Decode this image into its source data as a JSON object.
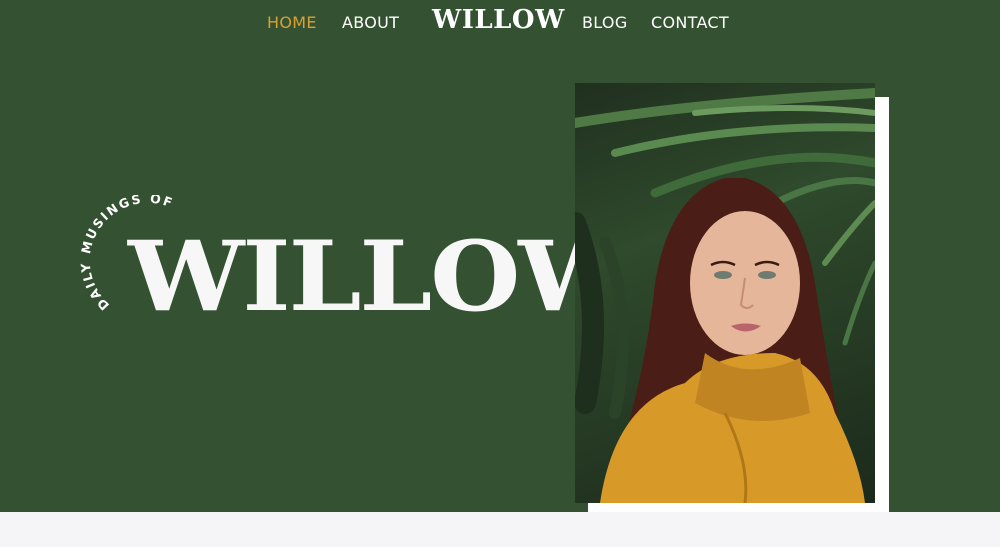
{
  "nav": {
    "items": [
      {
        "label": "HOME",
        "active": true
      },
      {
        "label": "ABOUT",
        "active": false
      },
      {
        "label": "BLOG",
        "active": false
      },
      {
        "label": "CONTACT",
        "active": false
      }
    ],
    "brand": "WILLOW"
  },
  "hero": {
    "arc_text": "DAILY MUSINGS OF",
    "title": "WILLOW",
    "photo_icon": "portrait-photo"
  },
  "colors": {
    "background": "#345232",
    "accent": "#d9a032",
    "text": "#ffffff",
    "footer": "#f5f4f6"
  }
}
